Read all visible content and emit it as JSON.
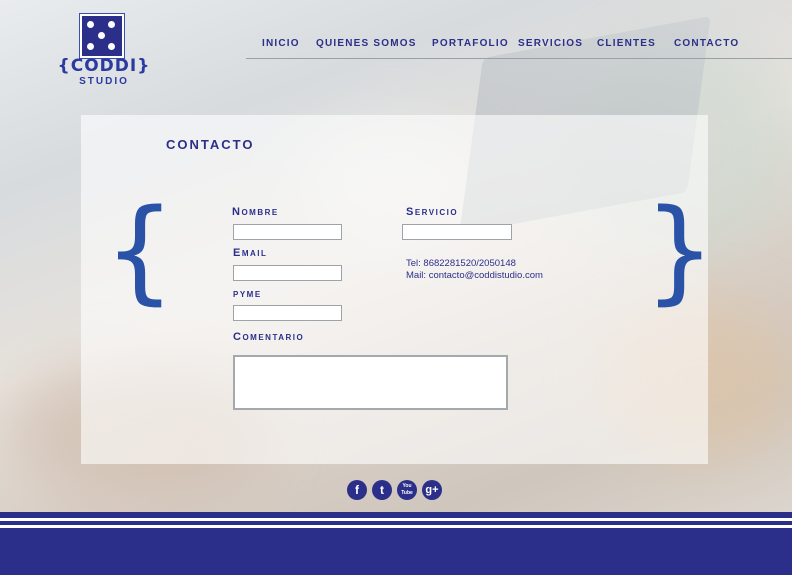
{
  "brand": {
    "name": "{CODDI}",
    "subtitle": "STUDIO"
  },
  "nav": {
    "items": [
      "INICIO",
      "QUIENES SOMOS",
      "PORTAFOLIO",
      "SERVICIOS",
      "CLIENTES",
      "CONTACTO"
    ]
  },
  "page": {
    "title": "CONTACTO"
  },
  "form": {
    "nombre_label": "Nombre",
    "email_label": "Email",
    "pyme_label": "pyme",
    "comentario_label": "Comentario",
    "servicio_label": "Servicio",
    "nombre_value": "",
    "email_value": "",
    "pyme_value": "",
    "servicio_value": "",
    "comentario_value": ""
  },
  "contact": {
    "tel": "Tel: 8682281520/2050148",
    "mail": "Mail: contacto@coddistudio.com"
  },
  "decor": {
    "left_brace": "{",
    "right_brace": "}"
  },
  "social": [
    {
      "icon": "facebook-icon",
      "glyph": "f"
    },
    {
      "icon": "twitter-icon",
      "glyph": "t"
    },
    {
      "icon": "youtube-icon",
      "glyph": "You Tube"
    },
    {
      "icon": "google-plus-icon",
      "glyph": "g+"
    }
  ],
  "colors": {
    "brand": "#2b2f8a",
    "brace": "#2a53a8"
  }
}
